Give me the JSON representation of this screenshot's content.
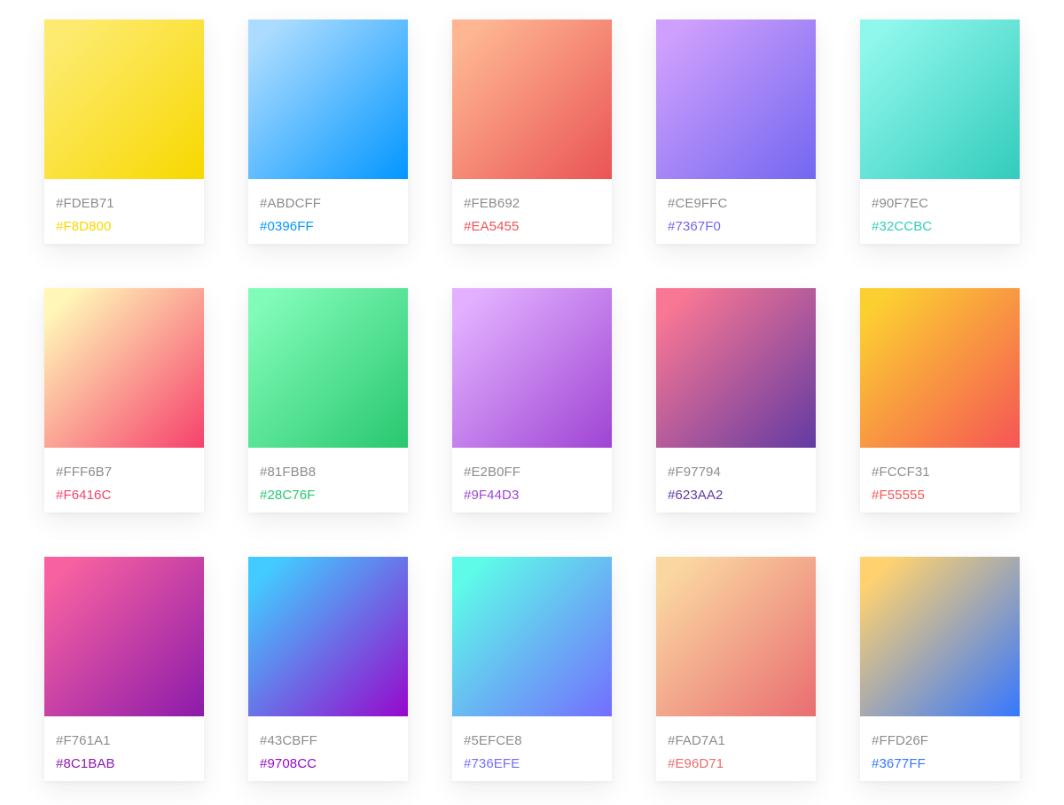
{
  "palettes": [
    {
      "start": "#FDEB71",
      "end": "#F8D800"
    },
    {
      "start": "#ABDCFF",
      "end": "#0396FF"
    },
    {
      "start": "#FEB692",
      "end": "#EA5455"
    },
    {
      "start": "#CE9FFC",
      "end": "#7367F0"
    },
    {
      "start": "#90F7EC",
      "end": "#32CCBC"
    },
    {
      "start": "#FFF6B7",
      "end": "#F6416C"
    },
    {
      "start": "#81FBB8",
      "end": "#28C76F"
    },
    {
      "start": "#E2B0FF",
      "end": "#9F44D3"
    },
    {
      "start": "#F97794",
      "end": "#623AA2"
    },
    {
      "start": "#FCCF31",
      "end": "#F55555"
    },
    {
      "start": "#F761A1",
      "end": "#8C1BAB"
    },
    {
      "start": "#43CBFF",
      "end": "#9708CC"
    },
    {
      "start": "#5EFCE8",
      "end": "#736EFE"
    },
    {
      "start": "#FAD7A1",
      "end": "#E96D71"
    },
    {
      "start": "#FFD26F",
      "end": "#3677FF"
    }
  ]
}
